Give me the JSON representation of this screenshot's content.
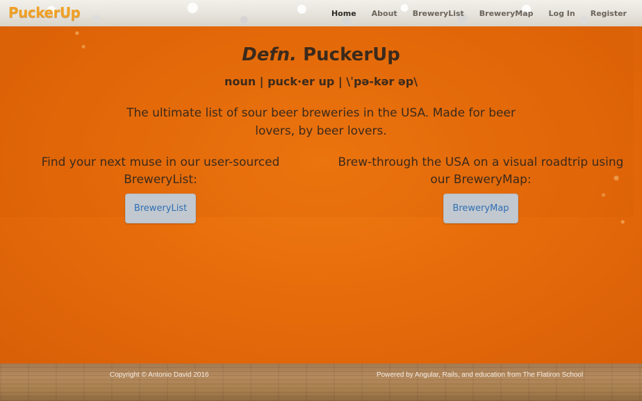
{
  "colors": {
    "brand": "#f0a024",
    "beer": "#e36a0c",
    "text": "#3b2a1c",
    "link": "#2f6fb3",
    "button_bg": "#c2c8cf"
  },
  "navbar": {
    "brand": "PuckerUp",
    "links": [
      {
        "label": "Home",
        "active": true
      },
      {
        "label": "About",
        "active": false
      },
      {
        "label": "BreweryList",
        "active": false
      },
      {
        "label": "BreweryMap",
        "active": false
      },
      {
        "label": "Log In",
        "active": false
      },
      {
        "label": "Register",
        "active": false
      }
    ]
  },
  "hero": {
    "title_prefix": "Defn.",
    "title_name": "PuckerUp",
    "pronunciation": "noun | puck·er up | \\ˈpə-kər əp\\",
    "tagline": "The ultimate list of sour beer breweries in the USA. Made for beer lovers, by beer lovers."
  },
  "sections": {
    "list": {
      "text": "Find your next muse in our user-sourced BreweryList:",
      "button": "BreweryList"
    },
    "map": {
      "text": "Brew-through the USA on a visual roadtrip using our BreweryMap:",
      "button": "BreweryMap"
    }
  },
  "footer": {
    "copyright": "Copyright © Antonio David 2016",
    "powered": "Powered by Angular, Rails, and education from The Flatiron School"
  }
}
